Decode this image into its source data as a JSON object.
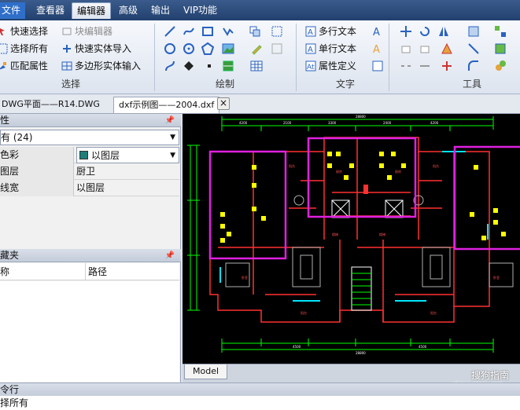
{
  "menu": {
    "items": [
      "文件",
      "查看器",
      "编辑器",
      "高级",
      "输出",
      "VIP功能"
    ],
    "active_index": 2
  },
  "ribbon": {
    "select": {
      "quick_select": "快速选择",
      "select_all": "选择所有",
      "match_properties": "匹配属性",
      "block_editor": "块编辑器",
      "quick_solid_import": "快速实体导入",
      "polygon_solid_input": "多边形实体输入",
      "group_label": "选择"
    },
    "draw": {
      "group_label": "绘制"
    },
    "text": {
      "mtext": "多行文本",
      "text": "单行文本",
      "attdef": "属性定义",
      "group_label": "文字"
    },
    "tools": {
      "group_label": "工具"
    }
  },
  "tabs": [
    {
      "label": "DWG平面——R14.DWG",
      "active": false
    },
    {
      "label": "dxf示例图——2004.dxf",
      "active": true
    }
  ],
  "properties_panel": {
    "title": "性",
    "selection": "有 (24)",
    "rows": [
      {
        "key": "色彩",
        "value": "以图层"
      },
      {
        "key": "图层",
        "value": "厨卫"
      },
      {
        "key": "线宽",
        "value": "以图层"
      }
    ],
    "swatch_color": "#1f7f78"
  },
  "favorites_panel": {
    "title": "藏夹",
    "col_name": "称",
    "col_path": "路径"
  },
  "layout_tab": "Model",
  "watermark": {
    "main": "搜狗指南",
    "sub": "zhinan.sogou.com"
  },
  "command": {
    "title": "令行",
    "text": "择所有"
  },
  "colors": {
    "highlight": "#e020e0",
    "canvas": "#000000",
    "wall": "#ff3030",
    "entity": "#ffff00",
    "dimension": "#00ff00"
  }
}
